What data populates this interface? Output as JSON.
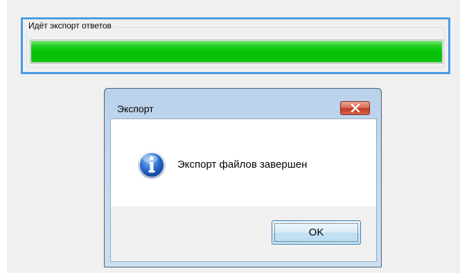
{
  "export_panel": {
    "group_title": "Идёт экспорт ответов",
    "progress_fraction": 1.0,
    "progress_color": "#06c606",
    "focus_border_color": "#4c9be5"
  },
  "dialog": {
    "title": "Экспорт",
    "close_icon": "close-x-icon",
    "message_icon": "info-icon",
    "message": "Экспорт файлов завершен",
    "ok_label": "OK"
  }
}
